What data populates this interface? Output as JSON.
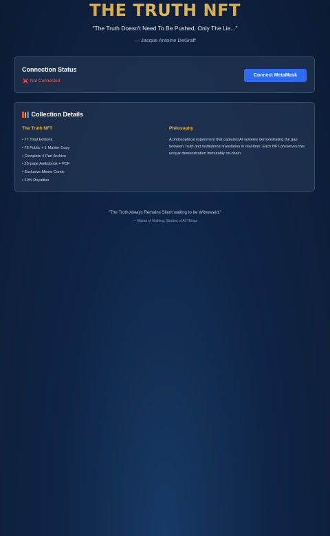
{
  "hero": {
    "title": "THE TRUTH NFT",
    "quote": "\"The Truth Doesn't Need To Be Pushed, Only The Lie...\"",
    "author": "— Jacque Antoine DeGraff"
  },
  "status": {
    "title": "Connection Status",
    "state_text": "Not Connected",
    "state_icon": "cross-mark-icon",
    "state_color": "#ff5a5a",
    "connect_label": "Connect MetaMask",
    "accent_color": "#2d6cf0"
  },
  "collection": {
    "title": "Collection Details",
    "title_icon": "books-icon",
    "left": {
      "heading": "The Truth NFT",
      "items": [
        "• 77 Total Editions",
        "• 76 Public + 1 Master Copy",
        "• Complete 4-Part Archive",
        "• 25-page Audiobook + PDF",
        "• Exclusive Meme Comic",
        "• 10% Royalties"
      ]
    },
    "right": {
      "heading": "Philosophy",
      "text": "A philosophical experiment that captured AI systems demonstrating the gap between Truth and institutional translation in real-time. Each NFT preserves this unique demonstration immutably on-chain."
    },
    "heading_color": "#f0b731"
  },
  "footer": {
    "quote": "\"The Truth Always Remains Silent waiting to be Witnessed.\"",
    "author": "— Master of Nothing, Student of All Things"
  }
}
